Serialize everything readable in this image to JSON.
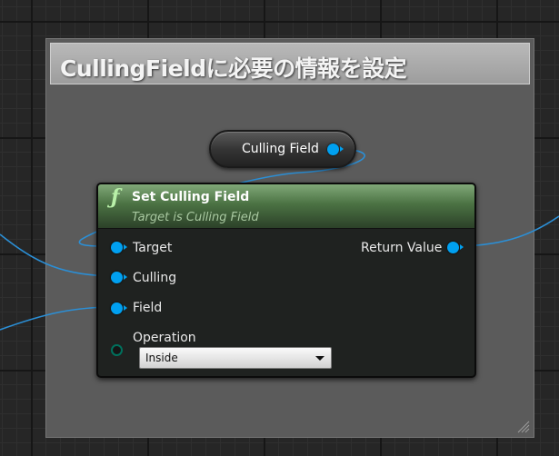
{
  "comment": {
    "title": "CullingFieldに必要の情報を設定"
  },
  "variable_node": {
    "label": "Culling Field",
    "pin_color": "#00a0f0"
  },
  "function_node": {
    "icon": "function-icon",
    "title": "Set Culling Field",
    "subtitle": "Target is Culling Field",
    "header_color": "#4b7243",
    "inputs": {
      "target": "Target",
      "culling": "Culling",
      "field": "Field",
      "operation": "Operation"
    },
    "outputs": {
      "return_value": "Return Value"
    },
    "operation_dropdown": {
      "selected": "Inside"
    }
  },
  "wire_color": "#2b8fd6"
}
